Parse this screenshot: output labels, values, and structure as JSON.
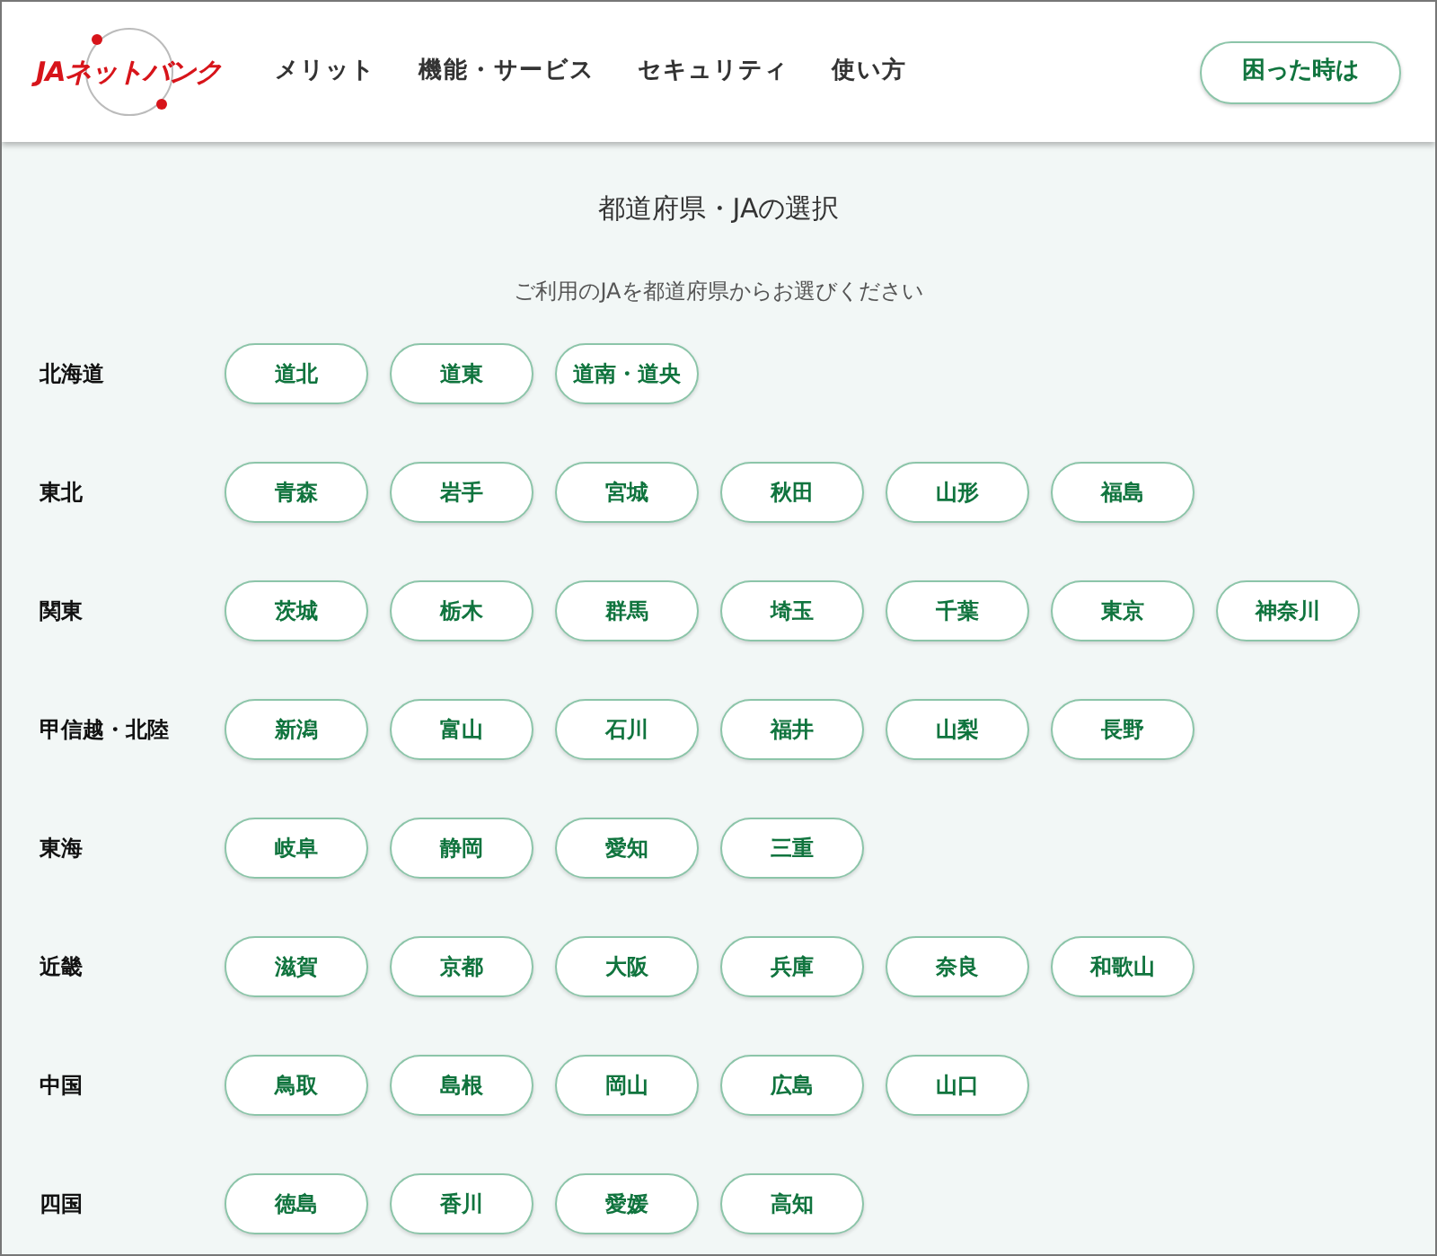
{
  "header": {
    "logo": "JAネットバンク",
    "nav": [
      "メリット",
      "機能・サービス",
      "セキュリティ",
      "使い方"
    ],
    "help_button": "困った時は"
  },
  "title": "都道府県・JAの選択",
  "instruction": "ご利用のJAを都道府県からお選びください",
  "regions": [
    {
      "name": "北海道",
      "prefectures": [
        "道北",
        "道東",
        "道南・道央"
      ]
    },
    {
      "name": "東北",
      "prefectures": [
        "青森",
        "岩手",
        "宮城",
        "秋田",
        "山形",
        "福島"
      ]
    },
    {
      "name": "関東",
      "prefectures": [
        "茨城",
        "栃木",
        "群馬",
        "埼玉",
        "千葉",
        "東京",
        "神奈川"
      ]
    },
    {
      "name": "甲信越・北陸",
      "prefectures": [
        "新潟",
        "富山",
        "石川",
        "福井",
        "山梨",
        "長野"
      ]
    },
    {
      "name": "東海",
      "prefectures": [
        "岐阜",
        "静岡",
        "愛知",
        "三重"
      ]
    },
    {
      "name": "近畿",
      "prefectures": [
        "滋賀",
        "京都",
        "大阪",
        "兵庫",
        "奈良",
        "和歌山"
      ]
    },
    {
      "name": "中国",
      "prefectures": [
        "鳥取",
        "島根",
        "岡山",
        "広島",
        "山口"
      ]
    },
    {
      "name": "四国",
      "prefectures": [
        "徳島",
        "香川",
        "愛媛",
        "高知"
      ]
    }
  ]
}
